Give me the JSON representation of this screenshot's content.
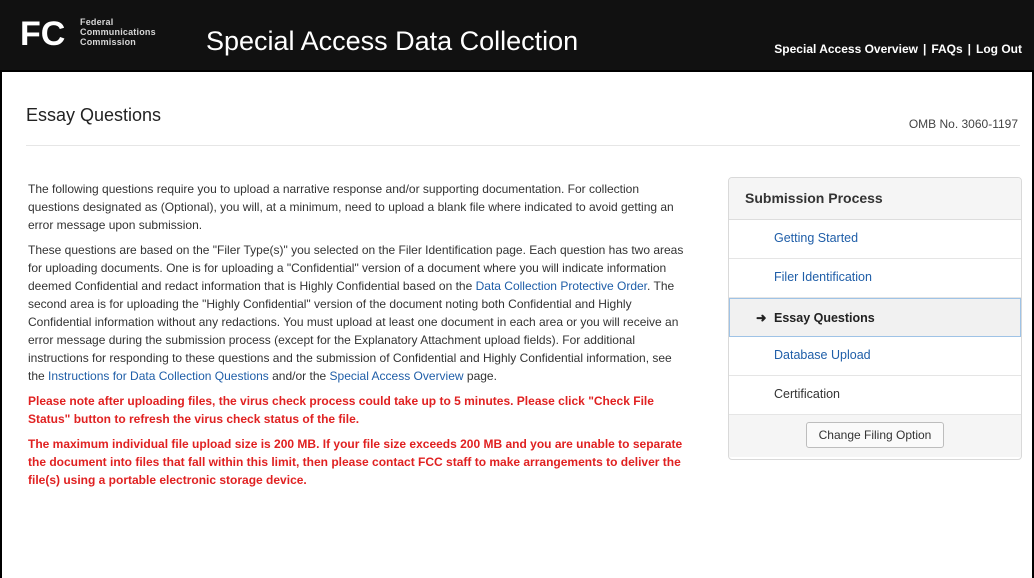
{
  "header": {
    "agency_lines": [
      "Federal",
      "Communications",
      "Commission"
    ],
    "title": "Special Access Data Collection",
    "nav": [
      "Special Access Overview",
      "FAQs",
      "Log Out"
    ]
  },
  "page": {
    "title": "Essay Questions",
    "omb": "OMB No. 3060-1197"
  },
  "intro": {
    "p1": "The following questions require you to upload a narrative response and/or supporting documentation. For collection questions designated as (Optional), you will, at a minimum, need to upload a blank file where indicated to avoid getting an error message upon submission.",
    "p2_a": "These questions are based on the \"Filer Type(s)\" you selected on the Filer Identification page. Each question has two areas for uploading documents. One is for uploading a \"Confidential\" version of a document where you will indicate information deemed Confidential and redact information that is Highly Confidential based on the ",
    "p2_link1": "Data Collection Protective Order",
    "p2_b": ". The second area is for uploading the \"Highly Confidential\" version of the document noting both Confidential and Highly Confidential information without any redactions. You must upload at least one document in each area or you will receive an error message during the submission process (except for the Explanatory Attachment upload fields). For additional instructions for responding to these questions and the submission of Confidential and Highly Confidential information, see the ",
    "p2_link2": "Instructions for Data Collection Questions",
    "p2_c": " and/or the ",
    "p2_link3": "Special Access Overview",
    "p2_d": " page.",
    "warn1": "Please note after uploading files, the virus check process could take up to 5 minutes. Please click \"Check File Status\" button to refresh the virus check status of the file.",
    "warn2": "The maximum individual file upload size is 200 MB. If your file size exceeds 200 MB and you are unable to separate the document into files that fall within this limit, then please contact FCC staff to make arrangements to deliver the file(s) using a portable electronic storage device."
  },
  "sidebar": {
    "title": "Submission Process",
    "steps": [
      {
        "label": "Getting Started"
      },
      {
        "label": "Filer Identification"
      },
      {
        "label": "Essay Questions",
        "active": true
      },
      {
        "label": "Database Upload"
      },
      {
        "label": "Certification"
      }
    ],
    "button": "Change Filing Option"
  },
  "colors": {
    "header_bg": "#111111",
    "link": "#1f5ea8",
    "warning": "#e02121"
  }
}
